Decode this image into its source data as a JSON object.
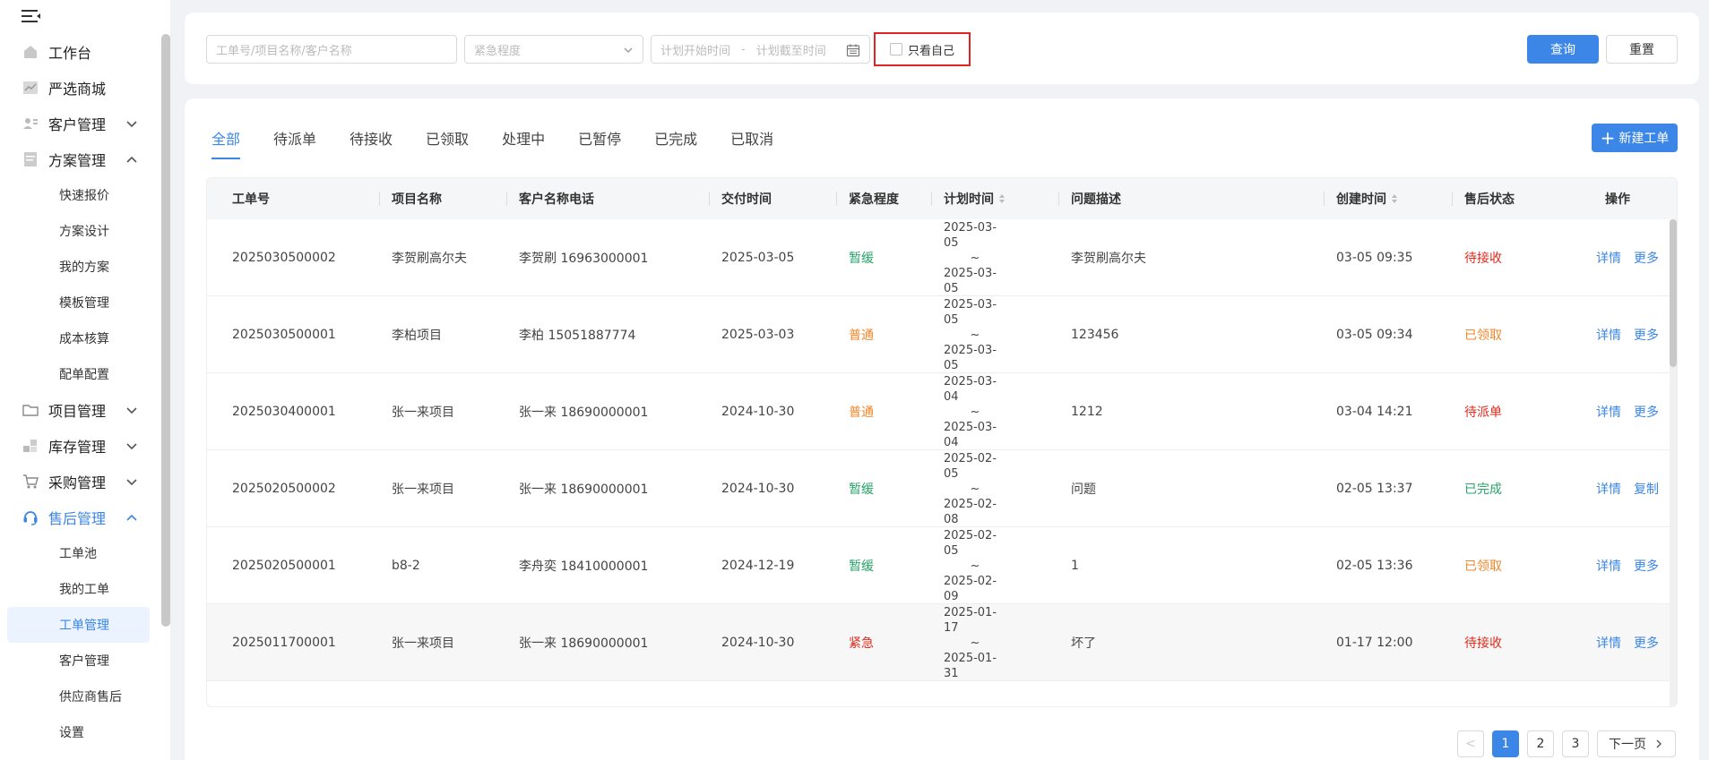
{
  "sidebar": {
    "items": [
      {
        "label": "工作台",
        "icon": "home-icon"
      },
      {
        "label": "严选商城",
        "icon": "chart-icon"
      },
      {
        "label": "客户管理",
        "icon": "user-card-icon",
        "expanded": false
      },
      {
        "label": "方案管理",
        "icon": "document-icon",
        "expanded": true,
        "children": [
          "快速报价",
          "方案设计",
          "我的方案",
          "模板管理",
          "成本核算",
          "配单配置"
        ]
      },
      {
        "label": "项目管理",
        "icon": "folder-icon",
        "expanded": false
      },
      {
        "label": "库存管理",
        "icon": "boxes-icon",
        "expanded": false
      },
      {
        "label": "采购管理",
        "icon": "cart-icon",
        "expanded": false
      },
      {
        "label": "售后管理",
        "icon": "headset-icon",
        "expanded": true,
        "active": true,
        "children": [
          "工单池",
          "我的工单",
          "工单管理",
          "客户管理",
          "供应商售后",
          "设置"
        ]
      }
    ],
    "active_child": "工单管理"
  },
  "filters": {
    "keyword_placeholder": "工单号/项目名称/客户名称",
    "urgency_placeholder": "紧急程度",
    "start_placeholder": "计划开始时间",
    "range_sep": "-",
    "end_placeholder": "计划截至时间",
    "only_mine_label": "只看自己",
    "only_mine_checked": false,
    "query_label": "查询",
    "reset_label": "重置"
  },
  "tabs": [
    "全部",
    "待派单",
    "待接收",
    "已领取",
    "处理中",
    "已暂停",
    "已完成",
    "已取消"
  ],
  "active_tab": 0,
  "new_button_label": "新建工单",
  "table": {
    "columns": [
      "工单号",
      "项目名称",
      "客户名称电话",
      "交付时间",
      "紧急程度",
      "计划时间",
      "问题描述",
      "创建时间",
      "售后状态",
      "操作"
    ],
    "rows": [
      {
        "id": "2025030500002",
        "project": "李贺刷高尔夫",
        "customer": "李贺刷  16963000001",
        "delivery": "2025-03-05",
        "urgency": "暂缓",
        "urgency_color": "#2aa36b",
        "plan_start": "2025-03-05",
        "plan_sep": "~",
        "plan_end": "2025-03-05",
        "desc": "李贺刷高尔夫",
        "created": "03-05 09:35",
        "status": "待接收",
        "status_color": "#e02a1c",
        "op1": "详情",
        "op2": "更多"
      },
      {
        "id": "2025030500001",
        "project": "李柏项目",
        "customer": "李柏  15051887774",
        "delivery": "2025-03-03",
        "urgency": "普通",
        "urgency_color": "#f0862b",
        "plan_start": "2025-03-05",
        "plan_sep": "~",
        "plan_end": "2025-03-05",
        "desc": "123456",
        "created": "03-05 09:34",
        "status": "已领取",
        "status_color": "#f0862b",
        "op1": "详情",
        "op2": "更多"
      },
      {
        "id": "2025030400001",
        "project": "张一来项目",
        "customer": "张一来  18690000001",
        "delivery": "2024-10-30",
        "urgency": "普通",
        "urgency_color": "#f0862b",
        "plan_start": "2025-03-04",
        "plan_sep": "~",
        "plan_end": "2025-03-04",
        "desc": "1212",
        "created": "03-04 14:21",
        "status": "待派单",
        "status_color": "#e02a1c",
        "op1": "详情",
        "op2": "更多"
      },
      {
        "id": "2025020500002",
        "project": "张一来项目",
        "customer": "张一来  18690000001",
        "delivery": "2024-10-30",
        "urgency": "暂缓",
        "urgency_color": "#2aa36b",
        "plan_start": "2025-02-05",
        "plan_sep": "~",
        "plan_end": "2025-02-08",
        "desc": "问题",
        "created": "02-05 13:37",
        "status": "已完成",
        "status_color": "#2aa36b",
        "op1": "详情",
        "op2": "复制"
      },
      {
        "id": "2025020500001",
        "project": "b8-2",
        "customer": "李舟奕  18410000001",
        "delivery": "2024-12-19",
        "urgency": "暂缓",
        "urgency_color": "#2aa36b",
        "plan_start": "2025-02-05",
        "plan_sep": "~",
        "plan_end": "2025-02-09",
        "desc": "1",
        "created": "02-05 13:36",
        "status": "已领取",
        "status_color": "#f0862b",
        "op1": "详情",
        "op2": "更多"
      },
      {
        "id": "2025011700001",
        "project": "张一来项目",
        "customer": "张一来  18690000001",
        "delivery": "2024-10-30",
        "urgency": "紧急",
        "urgency_color": "#e02a1c",
        "plan_start": "2025-01-17",
        "plan_sep": "~",
        "plan_end": "2025-01-31",
        "desc": "坏了",
        "created": "01-17 12:00",
        "status": "待接收",
        "status_color": "#e02a1c",
        "op1": "详情",
        "op2": "更多"
      }
    ]
  },
  "pagination": {
    "prev_label": "<",
    "pages": [
      "1",
      "2",
      "3"
    ],
    "current": "1",
    "next_label": "下一页"
  }
}
